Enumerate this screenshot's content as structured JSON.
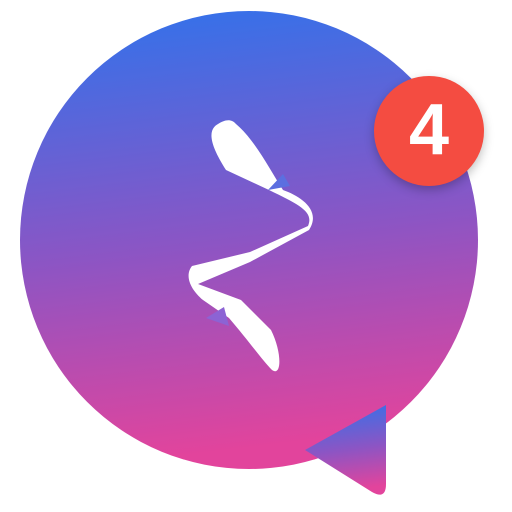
{
  "app_icon": {
    "name": "messenger-chat-bubble",
    "icon": "lightning-bolt-icon",
    "colors": {
      "gradient_top": "#2f73ec",
      "gradient_middle": "#8c55c4",
      "gradient_bottom": "#e2449c",
      "bolt": "#ffffff",
      "bolt_accent": "#5c6fe0"
    }
  },
  "badge": {
    "count": "4",
    "color": "#f44c41",
    "text_color": "#ffffff"
  }
}
